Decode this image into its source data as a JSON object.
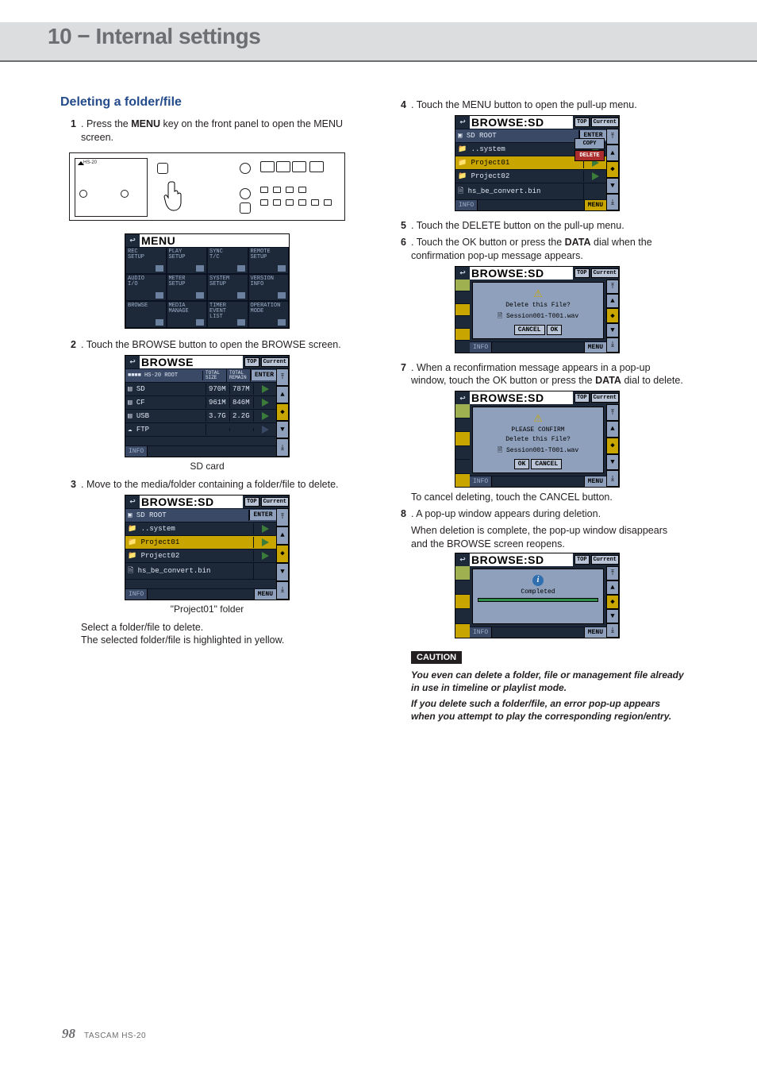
{
  "header": {
    "title": "10 − Internal settings"
  },
  "left": {
    "h2": "Deleting a folder/file",
    "step1": {
      "num": "1",
      "pre": ". Press the ",
      "bold": "MENU",
      "post": " key on the front panel to open the MENU screen."
    },
    "menu_panel": {
      "title": "MENU",
      "cells": [
        [
          "REC\nSETUP",
          "PLAY\nSETUP",
          "SYNC\nT/C",
          "REMOTE\nSETUP"
        ],
        [
          "AUDIO\nI/O",
          "METER\nSETUP",
          "SYSTEM\nSETUP",
          "VERSION\nINFO"
        ],
        [
          "BROWSE",
          "MEDIA\nMANAGE",
          "TIMER\nEVENT\nLIST",
          "OPERATION\nMODE"
        ]
      ]
    },
    "step2": {
      "num": "2",
      "text": ". Touch the BROWSE button to open the BROWSE screen."
    },
    "browse_panel": {
      "title": "BROWSE",
      "top_btn1": "TOP",
      "top_btn2": "Current",
      "path_label": "HS-20 ROOT",
      "hdr1": "TOTAL\nSIZE",
      "hdr2": "TOTAL\nREMAIN",
      "enter": "ENTER",
      "rows": [
        {
          "name": "SD",
          "c1": "970M",
          "c2": "787M"
        },
        {
          "name": "CF",
          "c1": "961M",
          "c2": "846M"
        },
        {
          "name": "USB",
          "c1": "3.7G",
          "c2": "2.2G"
        },
        {
          "name": "FTP",
          "c1": "",
          "c2": ""
        }
      ],
      "info": "INFO"
    },
    "browse_caption": "SD card",
    "step3": {
      "num": "3",
      "text": ". Move to the media/folder containing a folder/file to delete."
    },
    "browse_sd_panel": {
      "title": "BROWSE:SD",
      "top_btn1": "TOP",
      "top_btn2": "Current",
      "path": "SD ROOT",
      "enter": "ENTER",
      "rows": [
        "..system",
        "Project01",
        "Project02",
        "hs_be_convert.bin"
      ],
      "selected_index": 1,
      "info": "INFO",
      "menu": "MENU"
    },
    "browse_sd_caption": "\"Project01\" folder",
    "sel_text1": "Select a folder/file to delete.",
    "sel_text2": "The selected folder/file is highlighted in yellow."
  },
  "right": {
    "step4": {
      "num": "4",
      "text": ". Touch the MENU button to open the pull-up menu."
    },
    "pullup_panel": {
      "title": "BROWSE:SD",
      "top_btn1": "TOP",
      "top_btn2": "Current",
      "path": "SD ROOT",
      "enter": "ENTER",
      "rows": [
        "..system",
        "Project01",
        "Project02",
        "hs_be_convert.bin"
      ],
      "selected_index": 1,
      "popup": [
        "COPY",
        "DELETE"
      ],
      "info": "INFO",
      "menu": "MENU"
    },
    "step5": {
      "num": "5",
      "text": ". Touch the DELETE button on the pull-up menu."
    },
    "step6": {
      "num": "6",
      "pre": ". Touch the OK button or press the ",
      "bold": "DATA",
      "post": " dial when the confirmation pop-up message appears."
    },
    "confirm_panel": {
      "title": "BROWSE:SD",
      "top_btn1": "TOP",
      "top_btn2": "Current",
      "dlg1": "Delete this File?",
      "dlg2": "Session001-T001.wav",
      "btn1": "CANCEL",
      "btn2": "OK",
      "info": "INFO",
      "menu": "MENU"
    },
    "step7": {
      "num": "7",
      "pre": ". When a reconfirmation message appears in a pop-up window, touch the OK button or press the ",
      "bold": "DATA",
      "post": " dial to delete."
    },
    "reconfirm_panel": {
      "title": "BROWSE:SD",
      "top_btn1": "TOP",
      "top_btn2": "Current",
      "dlg0": "PLEASE CONFIRM",
      "dlg1": "Delete this File?",
      "dlg2": "Session001-T001.wav",
      "btn1": "OK",
      "btn2": "CANCEL",
      "info": "INFO",
      "menu": "MENU"
    },
    "cancel_note": "To cancel deleting, touch the CANCEL button.",
    "step8": {
      "num": "8",
      "text": ". A pop-up window appears during deletion."
    },
    "step8b": "When deletion is complete, the pop-up window disappears and the BROWSE screen reopens.",
    "complete_panel": {
      "title": "BROWSE:SD",
      "top_btn1": "TOP",
      "top_btn2": "Current",
      "dlg1": "Completed",
      "info": "INFO",
      "menu": "MENU"
    },
    "caution_label": "CAUTION",
    "caution1": "You even can delete a folder, file or management file already in use in timeline or playlist mode.",
    "caution2": "If you delete such a folder/file, an error pop-up appears when you attempt to play the corresponding region/entry."
  },
  "footer": {
    "page": "98",
    "model": "TASCAM HS-20"
  }
}
